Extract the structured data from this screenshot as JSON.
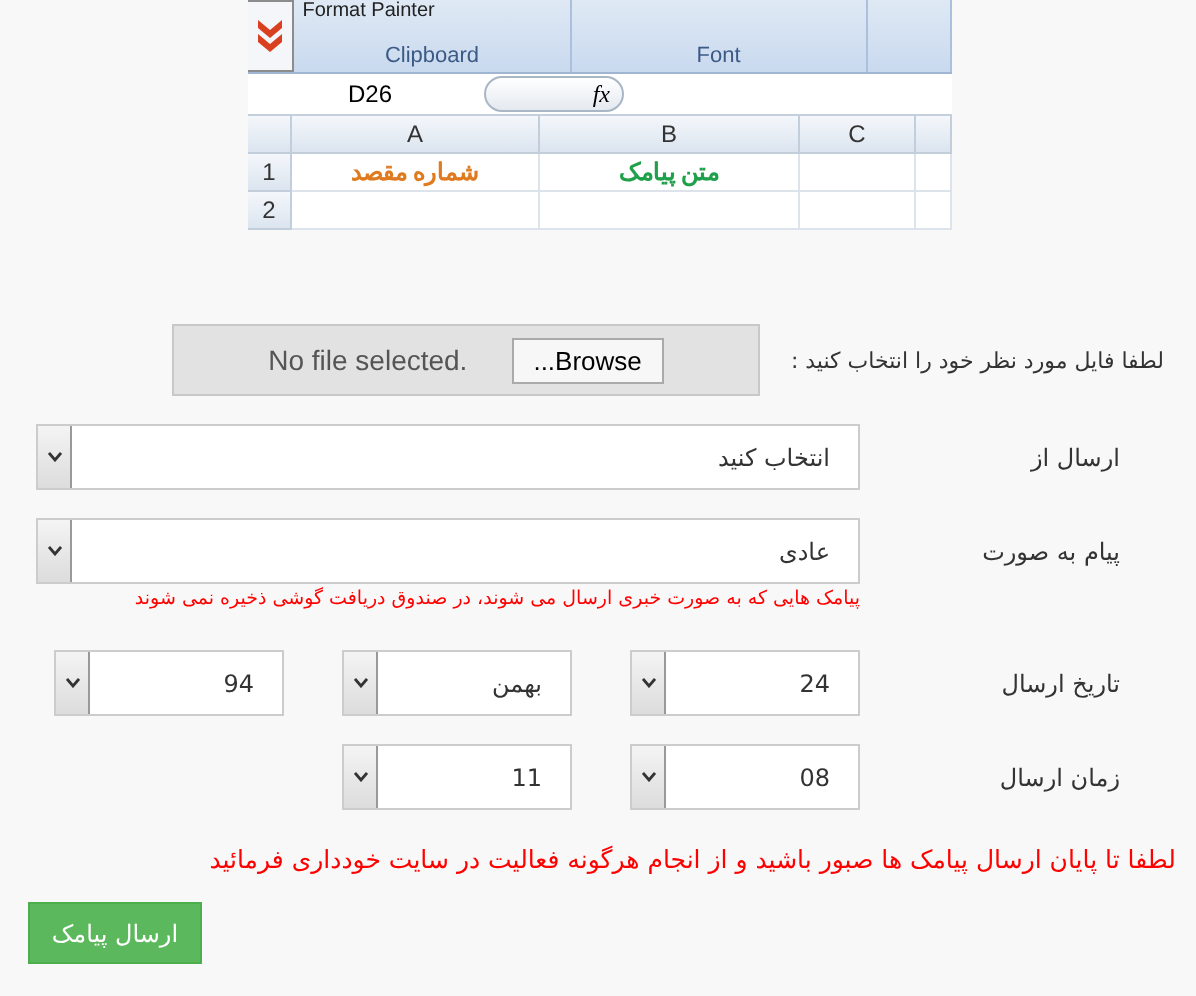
{
  "spreadsheet_image": {
    "ribbon": {
      "command": "Format Painter",
      "groups": [
        "Font",
        "Clipboard"
      ]
    },
    "name_box": "D26",
    "formula_label": "fx",
    "columns": [
      "C",
      "B",
      "A"
    ],
    "rows": [
      {
        "number": "1",
        "cells": [
          {
            "text": "متن پیامک",
            "color": "#1fa04a"
          },
          {
            "text": "شماره مقصد",
            "color": "#e07a1f"
          }
        ]
      },
      {
        "number": "2"
      }
    ]
  },
  "file_upload": {
    "label": "لطفا فایل مورد نظر خود را انتخاب کنید :",
    "button": "Browse...",
    "status": "No file selected."
  },
  "sender": {
    "label": "ارسال از",
    "value": "انتخاب کنید"
  },
  "message_type": {
    "label": "پیام به صورت",
    "value": "عادی",
    "hint": "پیامک هایی که به صورت خبری ارسال می شوند، در صندوق دریافت گوشی ذخیره نمی شوند"
  },
  "send_date": {
    "label": "تاریخ ارسال",
    "parts": [
      "24",
      "بهمن",
      "94"
    ]
  },
  "send_time": {
    "label": "زمان ارسال",
    "parts": [
      "08",
      "11"
    ]
  },
  "warning": "لطفا تا پایان ارسال پیامک ها صبور باشید و از انجام هرگونه فعالیت در سایت خودداری فرمائید",
  "submit_button": "ارسال پیامک"
}
